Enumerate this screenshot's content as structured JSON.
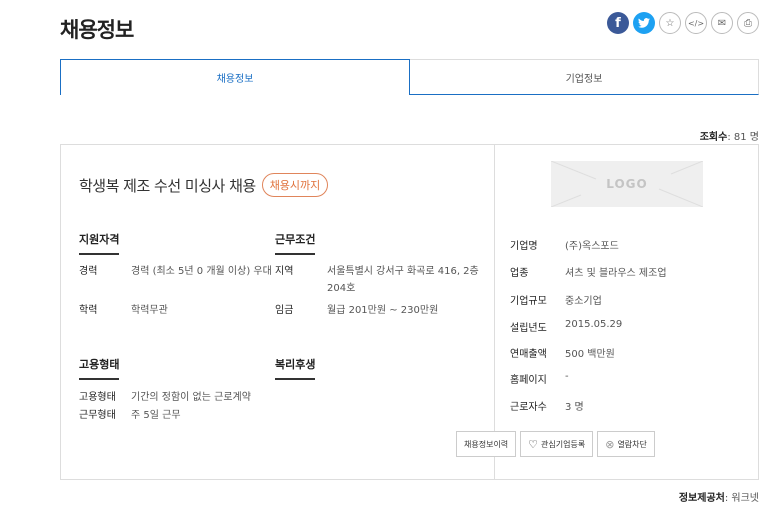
{
  "page": {
    "title": "채용정보"
  },
  "share": {
    "facebook": "f",
    "twitter": "t",
    "bookmark": "☆",
    "embed": "</>",
    "mail": "✉",
    "print": "⎙"
  },
  "tabs": [
    {
      "label": "채용정보"
    },
    {
      "label": "기업정보"
    }
  ],
  "views": {
    "label": "조회수",
    "value": ": 81 명"
  },
  "job": {
    "title": "학생복 제조 수선 미싱사 채용",
    "deadline_badge": "채용시까지",
    "qualifications": {
      "heading": "지원자격",
      "rows": [
        {
          "key": "경력",
          "value": "경력 (최소 5년 0 개월 이상) 우대"
        },
        {
          "key": "학력",
          "value": "학력무관"
        }
      ]
    },
    "conditions": {
      "heading": "근무조건",
      "rows": [
        {
          "key": "지역",
          "value": "서울특별시 강서구 화곡로 416, 2층 204호"
        },
        {
          "key": "임금",
          "value": "월급 201만원 ~ 230만원"
        }
      ]
    },
    "employment": {
      "heading": "고용형태",
      "rows": [
        {
          "key": "고용형태",
          "value": "기간의 정함이 없는 근로계약"
        },
        {
          "key": "근무형태",
          "value": "주 5일 근무"
        }
      ]
    },
    "welfare": {
      "heading": "복리후생"
    }
  },
  "company": {
    "logo_text": "LOGO",
    "rows": [
      {
        "key": "기업명",
        "value": "(주)옥스포드"
      },
      {
        "key": "업종",
        "value": "셔츠 및 블라우스 제조업"
      },
      {
        "key": "기업규모",
        "value": "중소기업"
      },
      {
        "key": "설립년도",
        "value": "2015.05.29"
      },
      {
        "key": "연매출액",
        "value": "500 백만원"
      },
      {
        "key": "홈페이지",
        "value": "-"
      },
      {
        "key": "근로자수",
        "value": "3 명"
      }
    ],
    "buttons": {
      "history": "채용정보이력",
      "interest": "관심기업등록",
      "block": "열람차단",
      "interest_icon": "♡",
      "block_icon": "⊗"
    }
  },
  "source": {
    "label": "정보제공처",
    "value": ": 워크넷"
  }
}
